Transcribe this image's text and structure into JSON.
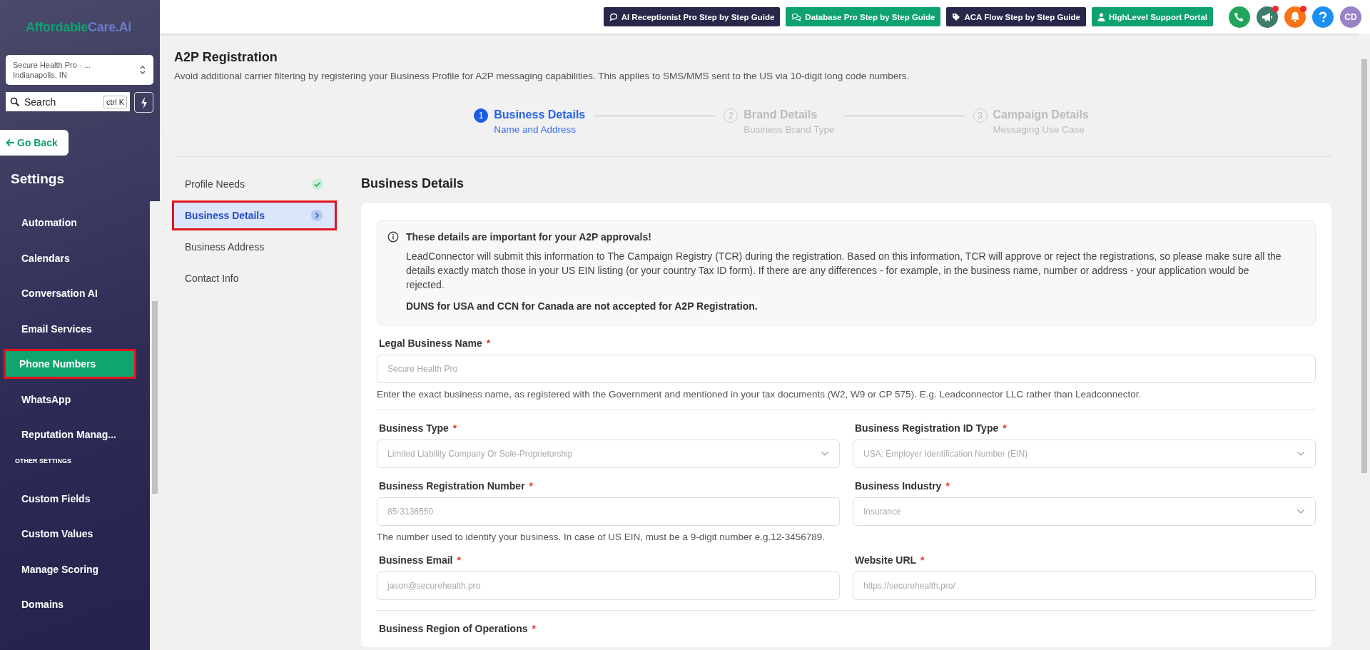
{
  "sidebar": {
    "logo": {
      "part1": "Affordable",
      "part2": "Care.Ai"
    },
    "account": {
      "name": "Secure Health Pro - ...",
      "location": "Indianapolis, IN"
    },
    "search": {
      "placeholder": "Search",
      "shortcut": "ctrl K"
    },
    "go_back": "Go Back",
    "heading": "Settings",
    "items": [
      {
        "kind": "item",
        "label": "Automation",
        "selected": false
      },
      {
        "kind": "item",
        "label": "Calendars",
        "selected": false
      },
      {
        "kind": "item",
        "label": "Conversation AI",
        "selected": false
      },
      {
        "kind": "item",
        "label": "Email Services",
        "selected": false
      },
      {
        "kind": "item",
        "label": "Phone Numbers",
        "selected": true
      },
      {
        "kind": "item",
        "label": "WhatsApp",
        "selected": false
      },
      {
        "kind": "item",
        "label": "Reputation Manag...",
        "selected": false
      },
      {
        "kind": "section",
        "label": "OTHER SETTINGS"
      },
      {
        "kind": "item",
        "label": "Custom Fields",
        "selected": false
      },
      {
        "kind": "item",
        "label": "Custom Values",
        "selected": false
      },
      {
        "kind": "item",
        "label": "Manage Scoring",
        "selected": false
      },
      {
        "kind": "item",
        "label": "Domains",
        "selected": false
      }
    ]
  },
  "topbar": {
    "guides": [
      {
        "kind": "chat",
        "label": "AI Receptionist Pro Step by Step Guide",
        "color": "#28284a"
      },
      {
        "kind": "chats",
        "label": "Database Pro Step by Step Guide",
        "color": "#0ea271"
      },
      {
        "kind": "tag",
        "label": "ACA Flow Step by Step Guide",
        "color": "#28284a"
      },
      {
        "kind": "user",
        "label": "HighLevel Support Portal",
        "color": "#0ea271"
      }
    ],
    "icons": [
      {
        "kind": "phone",
        "color": "#22a55a",
        "badge": false
      },
      {
        "kind": "megaphone",
        "color": "#3d7d6a",
        "badge": true
      },
      {
        "kind": "bell",
        "color": "#f97316",
        "badge": true
      },
      {
        "kind": "help",
        "color": "#1d8ff0",
        "badge": false
      },
      {
        "kind": "avatar",
        "color": "#9a82c8",
        "badge": false,
        "label": "CD"
      }
    ]
  },
  "page": {
    "title": "A2P Registration",
    "subtitle": "Avoid additional carrier filtering by registering your Business Profile for A2P messaging capabilities. This applies to SMS/MMS sent to the US via 10-digit long code numbers."
  },
  "steps": [
    {
      "number": "1",
      "title": "Business Details",
      "subtitle": "Name and Address",
      "selected": true
    },
    {
      "number": "2",
      "title": "Brand Details",
      "subtitle": "Business Brand Type",
      "selected": false
    },
    {
      "number": "3",
      "title": "Campaign Details",
      "subtitle": "Messaging Use Case",
      "selected": false
    }
  ],
  "subnav": [
    {
      "label": "Profile Needs",
      "selected": false,
      "done": true
    },
    {
      "label": "Business Details",
      "selected": true,
      "done": false
    },
    {
      "label": "Business Address",
      "selected": false,
      "done": false
    },
    {
      "label": "Contact Info",
      "selected": false,
      "done": false
    }
  ],
  "form": {
    "title": "Business Details",
    "notice": {
      "title": "These details are important for your A2P approvals!",
      "body": "LeadConnector will submit this information to The Campaign Registry (TCR) during the registration. Based on this information, TCR will approve or reject the registrations, so please make sure all the details exactly match those in your US EIN listing (or your country Tax ID form). If there are any differences - for example, in the business name, number or address - your application would be rejected.",
      "note": "DUNS for USA and CCN for Canada are not accepted for A2P Registration."
    },
    "groups": [
      {
        "divider": true,
        "help": "Enter the exact business name, as registered with the Government and mentioned in your tax documents (W2, W9 or CP 575). E.g. Leadconnector LLC rather than Leadconnector.",
        "fields": [
          {
            "kind": "text",
            "label": "Legal Business Name",
            "required_mark": "*",
            "value": "Secure Health Pro"
          }
        ]
      },
      {
        "divider": false,
        "fields": [
          {
            "kind": "select",
            "label": "Business Type",
            "required_mark": "*",
            "value": "Limited Liability Company Or Sole-Proprietorship"
          },
          {
            "kind": "select",
            "label": "Business Registration ID Type",
            "required_mark": "*",
            "value": "USA: Employer Identification Number (EIN)"
          }
        ]
      },
      {
        "divider": false,
        "help": "The number used to identify your business. In case of US EIN, must be a 9-digit number e.g.12-3456789.",
        "fields": [
          {
            "kind": "text",
            "label": "Business Registration Number",
            "required_mark": "*",
            "value": "85-3136550"
          },
          {
            "kind": "select",
            "label": "Business Industry",
            "required_mark": "*",
            "value": "Insurance"
          }
        ]
      },
      {
        "divider": true,
        "fields": [
          {
            "kind": "text",
            "label": "Business Email",
            "required_mark": "*",
            "value": "jason@securehealth.pro"
          },
          {
            "kind": "text",
            "label": "Website URL",
            "required_mark": "*",
            "value": "https://securehealth.pro/"
          }
        ]
      },
      {
        "fields": [
          {
            "kind": "label",
            "label": "Business Region of Operations",
            "required_mark": "*"
          }
        ]
      }
    ]
  }
}
